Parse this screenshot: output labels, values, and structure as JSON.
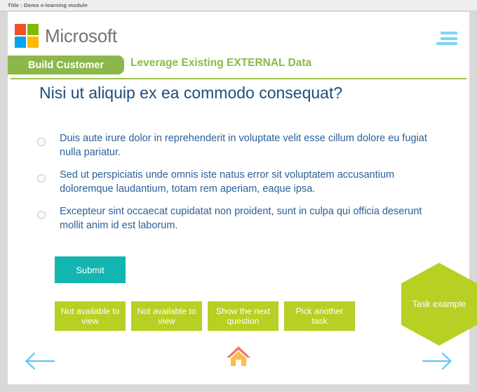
{
  "window": {
    "title_label": "Title : Demo e-learning module"
  },
  "header": {
    "brand_name": "Microsoft",
    "logo_icon": "microsoft-logo-icon",
    "menu_icon": "hamburger-menu-icon",
    "colors": {
      "logo_red": "#f25022",
      "logo_green": "#7fba00",
      "logo_blue": "#00a4ef",
      "logo_yellow": "#ffb900",
      "menu_blue": "#7fd4f7"
    }
  },
  "tabs": {
    "active_tab_label": "Build Customer",
    "section_title": "Leverage Existing EXTERNAL Data",
    "accent_green": "#8cb84b"
  },
  "quiz": {
    "question": "Nisi ut aliquip ex ea commodo consequat?",
    "options": [
      {
        "label": "Duis aute irure dolor in reprehenderit in voluptate velit esse cillum dolore eu fugiat nulla pariatur.",
        "selected": false
      },
      {
        "label": "Sed ut perspiciatis unde omnis iste natus error sit voluptatem accusantium doloremque laudantium, totam rem aperiam, eaque ipsa.",
        "selected": false
      },
      {
        "label": "Excepteur sint occaecat cupidatat non proident, sunt in culpa qui officia deserunt mollit anim id est laborum.",
        "selected": false
      }
    ],
    "submit_label": "Submit",
    "submit_color": "#13b5b1"
  },
  "actions": {
    "button_color": "#b8cf24",
    "buttons": [
      {
        "label": "Not available to view"
      },
      {
        "label": "Not available to view"
      },
      {
        "label": "Show the next question"
      },
      {
        "label": "Pick another task"
      }
    ]
  },
  "task_shape": {
    "label": "Task example",
    "shape": "hexagon",
    "color": "#b8cf24"
  },
  "bottom_nav": {
    "prev_icon": "arrow-left-icon",
    "home_icon": "home-icon",
    "next_icon": "arrow-right-icon",
    "arrow_color": "#5bc8f5",
    "home_roof_color": "#f4756b",
    "home_body_color": "#fbbd4a"
  }
}
